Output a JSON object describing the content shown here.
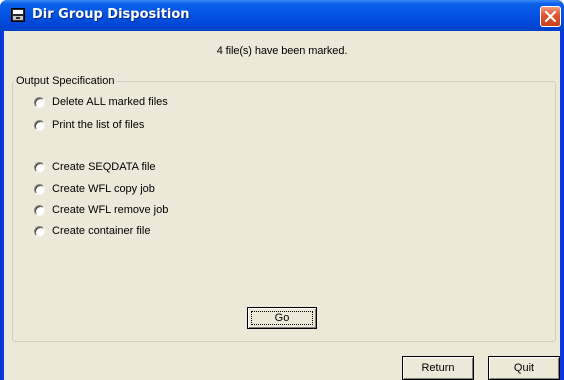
{
  "window": {
    "title": "Dir Group Disposition",
    "accent_color": "#0054e3",
    "close_color": "#e0542c",
    "icons": [
      "app-window-icon",
      "close-icon"
    ]
  },
  "message": "4 file(s) have been marked.",
  "output_spec": {
    "legend": "Output Specification",
    "options": [
      {
        "label": "Delete ALL marked files",
        "selected": false
      },
      {
        "label": "Print the list of files",
        "selected": false
      },
      {
        "label": "Create SEQDATA file",
        "selected": false
      },
      {
        "label": "Create WFL copy job",
        "selected": false
      },
      {
        "label": "Create WFL remove job",
        "selected": false
      },
      {
        "label": "Create container file",
        "selected": false
      }
    ],
    "go_label": "Go"
  },
  "footer": {
    "return_label": "Return",
    "quit_label": "Quit"
  }
}
